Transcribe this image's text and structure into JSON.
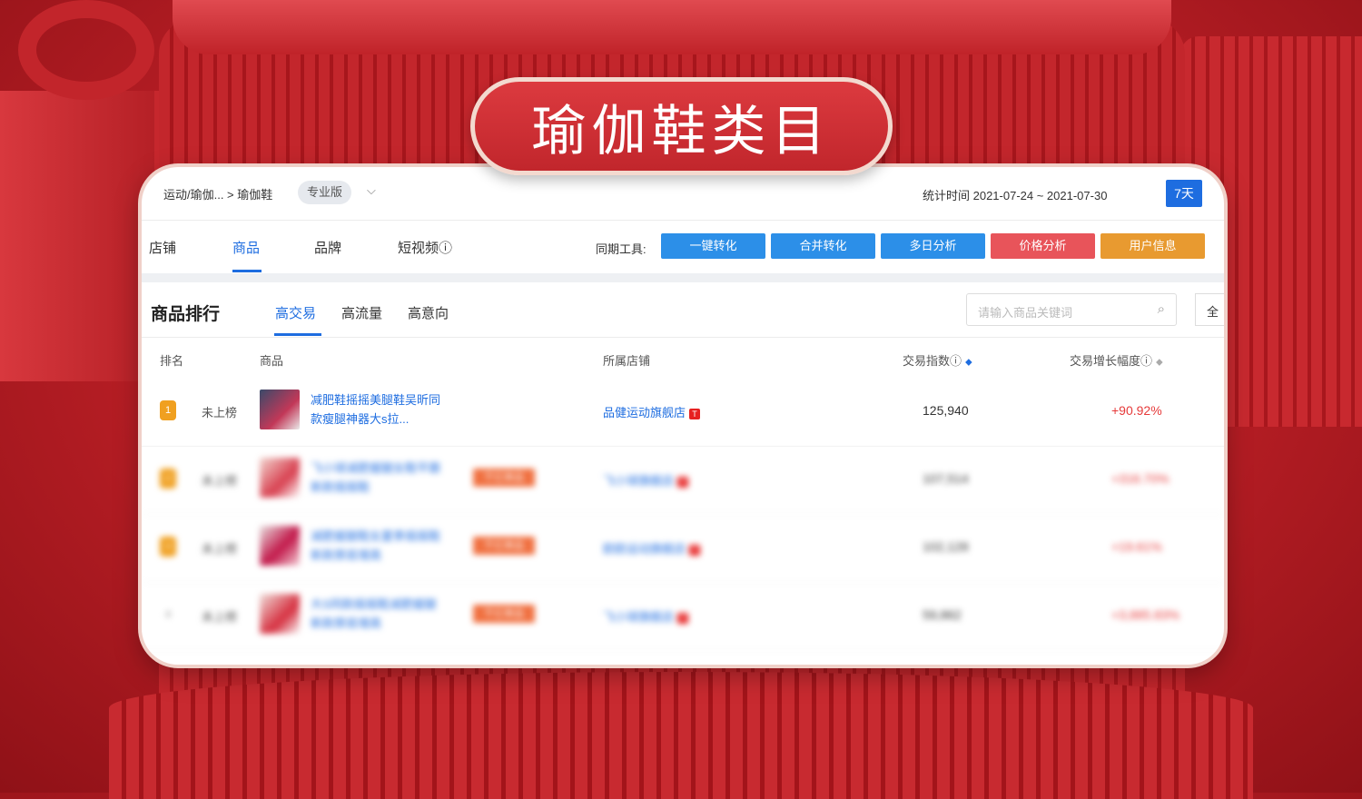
{
  "banner": {
    "title": "瑜伽鞋类目"
  },
  "header": {
    "breadcrumb": "运动/瑜伽... > 瑜伽鞋",
    "edition": "专业版",
    "stat_time": "统计时间 2021-07-24 ~ 2021-07-30",
    "period_button": "7天"
  },
  "nav": {
    "tabs": [
      "店铺",
      "商品",
      "品牌",
      "短视频ⓘ"
    ],
    "active_tab": "商品",
    "tools_label": "同期工具:",
    "tools": [
      {
        "label": "一键转化",
        "color": "#2c8fe8"
      },
      {
        "label": "合并转化",
        "color": "#2c8fe8"
      },
      {
        "label": "多日分析",
        "color": "#2c8fe8"
      },
      {
        "label": "价格分析",
        "color": "#e8545a"
      },
      {
        "label": "用户信息",
        "color": "#e89a30"
      }
    ]
  },
  "ranking": {
    "title": "商品排行",
    "subtabs": [
      "高交易",
      "高流量",
      "高意向"
    ],
    "active_subtab": "高交易",
    "search_placeholder": "请输入商品关键词",
    "all_button": "全"
  },
  "table": {
    "columns": {
      "rank": "排名",
      "product": "商品",
      "shop": "所属店铺",
      "trade_index": "交易指数ⓘ",
      "growth": "交易增长幅度ⓘ"
    },
    "rows": [
      {
        "medal": "1",
        "rank_status": "未上榜",
        "product": "减肥鞋摇摇美腿鞋吴昕同款瘦腿神器大s拉...",
        "hot_tag": "",
        "shop": "品健运动旗舰店",
        "trade_index": "125,940",
        "growth": "+90.92%"
      },
      {
        "medal": "2",
        "rank_status": "未上榜",
        "product": "飞小球减肥瘦腿女鞋平跟新款摇摇鞋",
        "hot_tag": "千亿单品",
        "shop": "飞小球旗舰店",
        "trade_index": "107,514",
        "growth": "+316.70%"
      },
      {
        "medal": "3",
        "rank_status": "未上榜",
        "product": "减肥瘦腿鞋女夏季摇摇鞋新款厚底增高",
        "hot_tag": "千亿单品",
        "shop": "欧欧运动旗舰店",
        "trade_index": "102,128",
        "growth": "+19.61%"
      },
      {
        "medal": "4",
        "rank_status": "未上榜",
        "product": "大S同款摇摇鞋减肥瘦腿新款厚底增高",
        "hot_tag": "千亿单品",
        "shop": "飞小球旗舰店",
        "trade_index": "59,862",
        "growth": "+3,885.83%"
      }
    ]
  }
}
